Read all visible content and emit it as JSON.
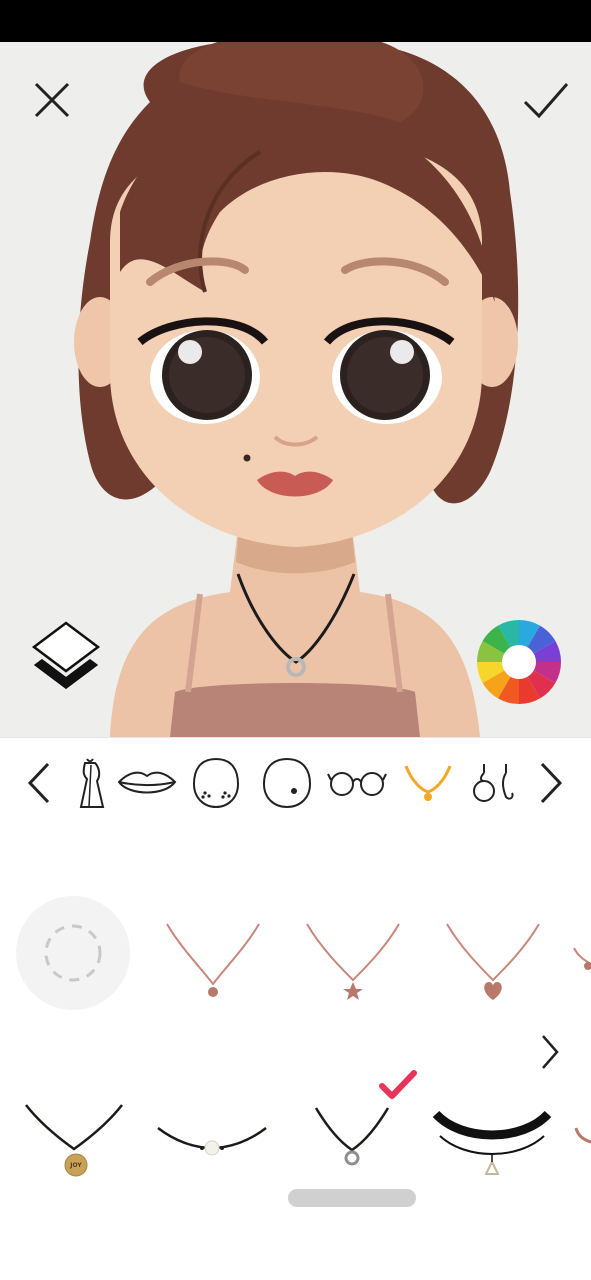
{
  "app": {
    "screen": "avatar-accessory-editor"
  },
  "toolbar": {
    "close_icon": "close-icon",
    "confirm_icon": "checkmark-icon",
    "layers_icon": "layers-icon",
    "color_icon": "color-wheel-icon"
  },
  "categories": {
    "prev_icon": "chevron-left-icon",
    "next_icon": "chevron-right-icon",
    "items": [
      {
        "name": "outfit",
        "icon": "dress-icon",
        "selected": false
      },
      {
        "name": "lips",
        "icon": "lips-icon",
        "selected": false
      },
      {
        "name": "face-marks",
        "icon": "freckles-icon",
        "selected": false
      },
      {
        "name": "mole",
        "icon": "mole-icon",
        "selected": false
      },
      {
        "name": "glasses",
        "icon": "glasses-icon",
        "selected": false
      },
      {
        "name": "necklace",
        "icon": "necklace-icon",
        "selected": true
      },
      {
        "name": "earrings",
        "icon": "earrings-icon",
        "selected": false
      }
    ],
    "accent_color": "#f5a623"
  },
  "options": {
    "row1": [
      {
        "name": "none",
        "icon": "empty-slot-icon",
        "selected": false
      },
      {
        "name": "rose-gold-bead-necklace",
        "icon": "necklace-bead-icon",
        "selected": false
      },
      {
        "name": "rose-gold-star-necklace",
        "icon": "necklace-star-icon",
        "selected": false
      },
      {
        "name": "rose-gold-heart-necklace",
        "icon": "necklace-heart-icon",
        "selected": false
      }
    ],
    "row2": [
      {
        "name": "joy-tag-necklace",
        "icon": "necklace-tag-icon",
        "tag_text": "JOY",
        "selected": false
      },
      {
        "name": "pearl-cord-necklace",
        "icon": "necklace-pearl-icon",
        "selected": false
      },
      {
        "name": "silver-ring-cord-necklace",
        "icon": "necklace-ring-icon",
        "selected": true
      },
      {
        "name": "black-choker-triangle",
        "icon": "choker-icon",
        "selected": false
      }
    ],
    "more_icon": "chevron-right-icon",
    "selected_icon": "checkmark-icon",
    "selected_color": "#e8335a"
  }
}
